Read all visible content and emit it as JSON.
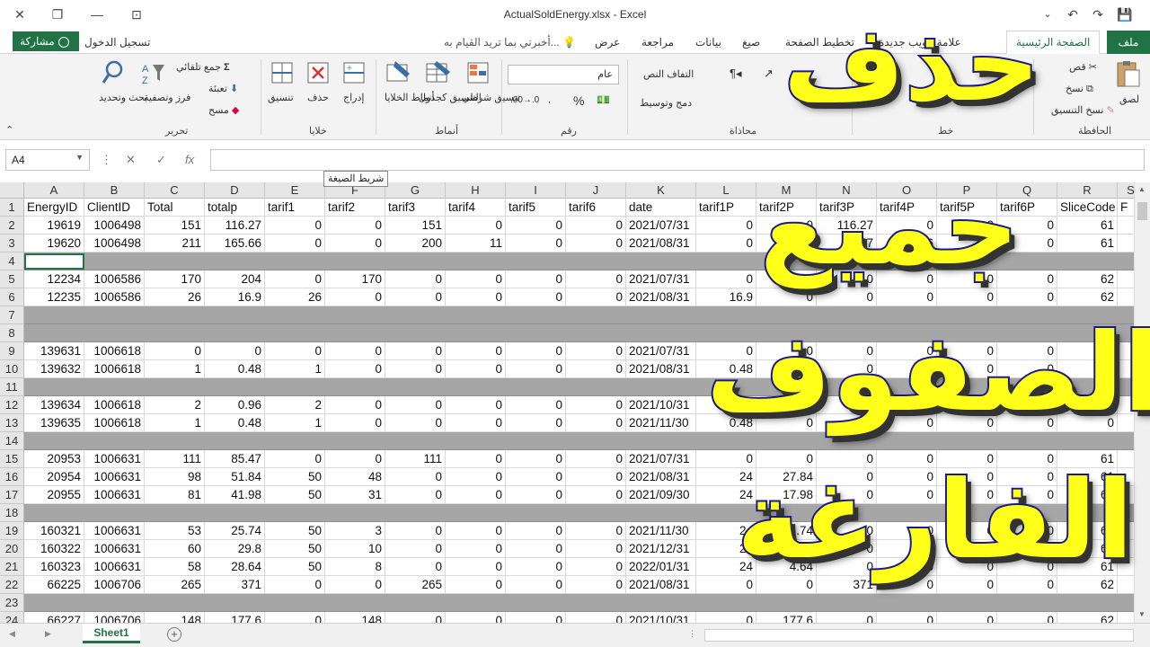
{
  "window": {
    "title": "ActualSoldEnergy.xlsx - Excel"
  },
  "tabs": {
    "file": "ملف",
    "items": [
      "الصفحة الرئيسية",
      "علامة تبويب جديدة",
      "تخطيط الصفحة",
      "صيغ",
      "بيانات",
      "مراجعة",
      "عرض"
    ],
    "active_index": 0,
    "tell_me": "أخبرني بما تريد القيام به...",
    "sign_in": "تسجيل الدخول",
    "share": "مشاركة"
  },
  "ribbon": {
    "clipboard": {
      "label": "الحافظة",
      "paste": "لصق",
      "cut": "قص",
      "copy": "نسخ",
      "format_painter": "نسخ التنسيق"
    },
    "font": {
      "label": "خط"
    },
    "alignment": {
      "label": "محاذاة",
      "wrap": "التفاف النص",
      "merge": "دمج وتوسيط"
    },
    "number": {
      "label": "رقم",
      "format": "عام",
      "percent": "%"
    },
    "styles": {
      "label": "أنماط",
      "conditional": "تنسيق شرطي",
      "table": "التنسيق كجدول",
      "cell_styles": "أنماط الخلايا"
    },
    "cells": {
      "label": "خلايا",
      "insert": "إدراج",
      "delete": "حذف",
      "format": "تنسيق"
    },
    "editing": {
      "label": "تحرير",
      "autosum": "جمع تلقائي",
      "fill": "تعبئة",
      "clear": "مسح",
      "sort": "فرز وتصفية",
      "find": "بحث وتحديد"
    }
  },
  "formula_bar": {
    "name_box": "A4",
    "fx": "fx",
    "tooltip": "شريط الصيغة",
    "value": ""
  },
  "sheet": {
    "columns": [
      "A",
      "B",
      "C",
      "D",
      "E",
      "F",
      "G",
      "H",
      "I",
      "J",
      "K",
      "L",
      "M",
      "N",
      "O",
      "P",
      "Q",
      "R",
      "S"
    ],
    "headers": [
      "EnergyID",
      "ClientID",
      "Total",
      "totalp",
      "tarif1",
      "tarif2",
      "tarif3",
      "tarif4",
      "tarif5",
      "tarif6",
      "date",
      "tarif1P",
      "tarif2P",
      "tarif3P",
      "tarif4P",
      "tarif5P",
      "tarif6P",
      "SliceCode",
      "F"
    ],
    "rows": [
      {
        "n": "2",
        "blank": false,
        "cells": [
          "19619",
          "1006498",
          "151",
          "116.27",
          "0",
          "0",
          "151",
          "0",
          "0",
          "0",
          "2021/07/31",
          "0",
          "0",
          "116.27",
          "0",
          "0",
          "0",
          "61",
          ""
        ]
      },
      {
        "n": "3",
        "blank": false,
        "cells": [
          "19620",
          "1006498",
          "211",
          "165.66",
          "0",
          "0",
          "200",
          "11",
          "0",
          "0",
          "2021/08/31",
          "0",
          "0",
          "157",
          "8.66",
          "0",
          "0",
          "61",
          ""
        ]
      },
      {
        "n": "4",
        "blank": true,
        "cells": []
      },
      {
        "n": "5",
        "blank": false,
        "cells": [
          "12234",
          "1006586",
          "170",
          "204",
          "0",
          "170",
          "0",
          "0",
          "0",
          "0",
          "2021/07/31",
          "0",
          "204",
          "0",
          "0",
          "0",
          "0",
          "62",
          ""
        ]
      },
      {
        "n": "6",
        "blank": false,
        "cells": [
          "12235",
          "1006586",
          "26",
          "16.9",
          "26",
          "0",
          "0",
          "0",
          "0",
          "0",
          "2021/08/31",
          "16.9",
          "0",
          "0",
          "0",
          "0",
          "0",
          "62",
          ""
        ]
      },
      {
        "n": "7",
        "blank": true,
        "cells": []
      },
      {
        "n": "8",
        "blank": true,
        "cells": []
      },
      {
        "n": "9",
        "blank": false,
        "cells": [
          "139631",
          "1006618",
          "0",
          "0",
          "0",
          "0",
          "0",
          "0",
          "0",
          "0",
          "2021/07/31",
          "0",
          "0",
          "0",
          "0",
          "0",
          "0",
          "0",
          ""
        ]
      },
      {
        "n": "10",
        "blank": false,
        "cells": [
          "139632",
          "1006618",
          "1",
          "0.48",
          "1",
          "0",
          "0",
          "0",
          "0",
          "0",
          "2021/08/31",
          "0.48",
          "0",
          "0",
          "0",
          "0",
          "0",
          "0",
          ""
        ]
      },
      {
        "n": "11",
        "blank": true,
        "cells": []
      },
      {
        "n": "12",
        "blank": false,
        "cells": [
          "139634",
          "1006618",
          "2",
          "0.96",
          "2",
          "0",
          "0",
          "0",
          "0",
          "0",
          "2021/10/31",
          "0.96",
          "0",
          "0",
          "0",
          "0",
          "0",
          "0",
          ""
        ]
      },
      {
        "n": "13",
        "blank": false,
        "cells": [
          "139635",
          "1006618",
          "1",
          "0.48",
          "1",
          "0",
          "0",
          "0",
          "0",
          "0",
          "2021/11/30",
          "0.48",
          "0",
          "0",
          "0",
          "0",
          "0",
          "0",
          ""
        ]
      },
      {
        "n": "14",
        "blank": true,
        "cells": []
      },
      {
        "n": "15",
        "blank": false,
        "cells": [
          "20953",
          "1006631",
          "111",
          "85.47",
          "0",
          "0",
          "111",
          "0",
          "0",
          "0",
          "2021/07/31",
          "0",
          "0",
          "0",
          "0",
          "0",
          "0",
          "61",
          ""
        ]
      },
      {
        "n": "16",
        "blank": false,
        "cells": [
          "20954",
          "1006631",
          "98",
          "51.84",
          "50",
          "48",
          "0",
          "0",
          "0",
          "0",
          "2021/08/31",
          "24",
          "27.84",
          "0",
          "0",
          "0",
          "0",
          "61",
          ""
        ]
      },
      {
        "n": "17",
        "blank": false,
        "cells": [
          "20955",
          "1006631",
          "81",
          "41.98",
          "50",
          "31",
          "0",
          "0",
          "0",
          "0",
          "2021/09/30",
          "24",
          "17.98",
          "0",
          "0",
          "0",
          "0",
          "61",
          ""
        ]
      },
      {
        "n": "18",
        "blank": true,
        "cells": []
      },
      {
        "n": "19",
        "blank": false,
        "cells": [
          "160321",
          "1006631",
          "53",
          "25.74",
          "50",
          "3",
          "0",
          "0",
          "0",
          "0",
          "2021/11/30",
          "24",
          "1.74",
          "0",
          "0",
          "0",
          "0",
          "61",
          ""
        ]
      },
      {
        "n": "20",
        "blank": false,
        "cells": [
          "160322",
          "1006631",
          "60",
          "29.8",
          "50",
          "10",
          "0",
          "0",
          "0",
          "0",
          "2021/12/31",
          "24",
          "5.8",
          "0",
          "0",
          "0",
          "0",
          "61",
          ""
        ]
      },
      {
        "n": "21",
        "blank": false,
        "cells": [
          "160323",
          "1006631",
          "58",
          "28.64",
          "50",
          "8",
          "0",
          "0",
          "0",
          "0",
          "2022/01/31",
          "24",
          "4.64",
          "0",
          "0",
          "0",
          "0",
          "61",
          ""
        ]
      },
      {
        "n": "22",
        "blank": false,
        "cells": [
          "66225",
          "1006706",
          "265",
          "371",
          "0",
          "0",
          "265",
          "0",
          "0",
          "0",
          "2021/08/31",
          "0",
          "0",
          "371",
          "0",
          "0",
          "0",
          "62",
          ""
        ]
      },
      {
        "n": "23",
        "blank": true,
        "cells": []
      },
      {
        "n": "24",
        "blank": false,
        "cells": [
          "66227",
          "1006706",
          "148",
          "177.6",
          "0",
          "148",
          "0",
          "0",
          "0",
          "0",
          "2021/10/31",
          "0",
          "177.6",
          "0",
          "0",
          "0",
          "0",
          "62",
          ""
        ]
      }
    ],
    "tab_name": "Sheet1"
  },
  "overlay": {
    "line1": "حذف",
    "line2": "جميع",
    "line3": "الصفوف",
    "line4": "الفارغة",
    "fill_color": "#ffff1a",
    "stroke_color": "#1a1a8c"
  },
  "colors": {
    "accent": "#217346",
    "blank_row": "#a6a6a6"
  }
}
